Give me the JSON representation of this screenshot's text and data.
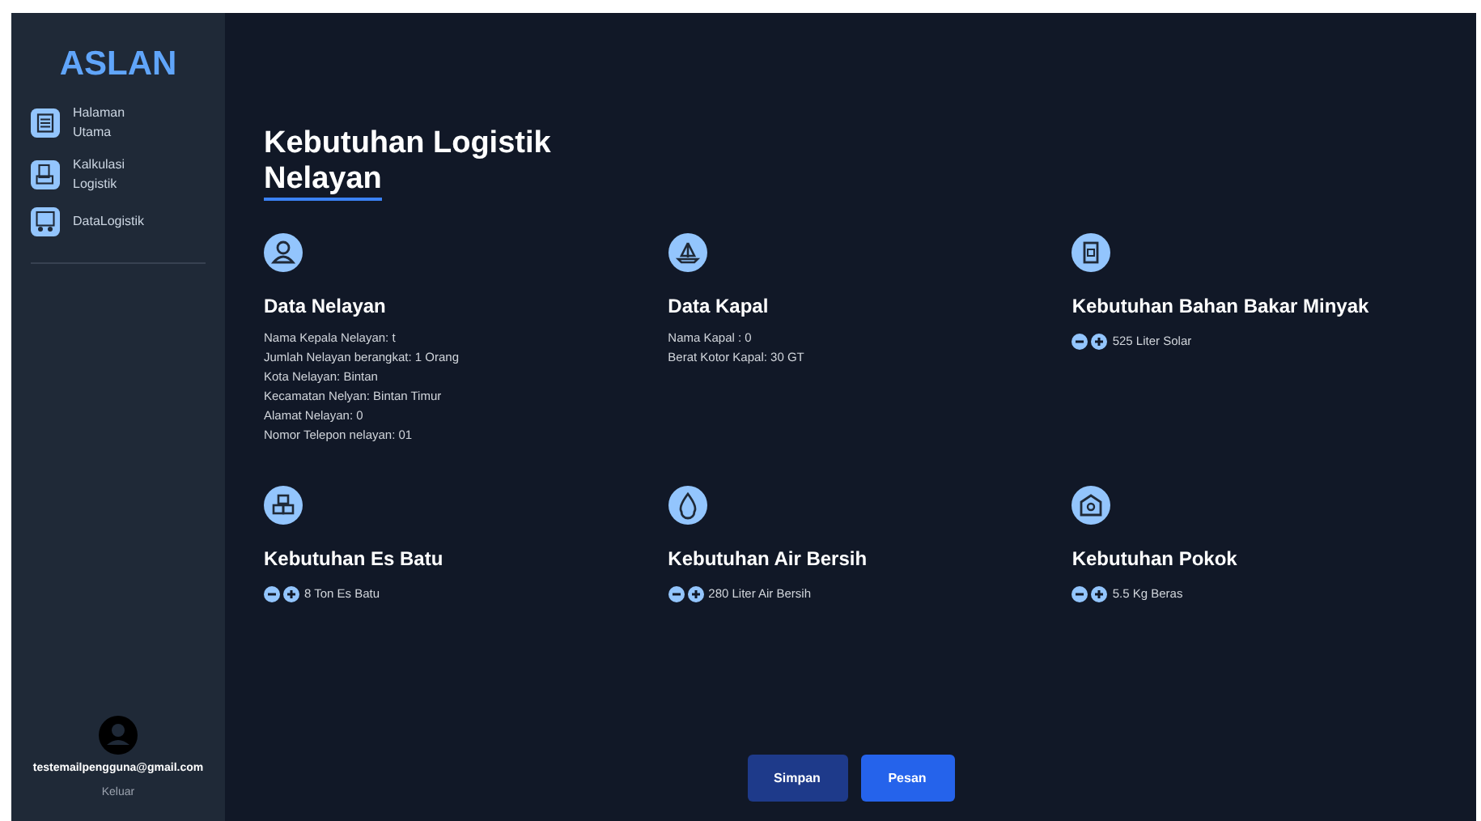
{
  "sidebar": {
    "brand": "ASLAN",
    "items": [
      {
        "label": "Halaman Utama"
      },
      {
        "label": "Kalkulasi Logistik"
      },
      {
        "label": "DataLogistik"
      }
    ],
    "user": {
      "email": "testemailpengguna@gmail.com",
      "logout": "Keluar"
    }
  },
  "title": "Kebutuhan Logistik",
  "title_underlined": "Nelayan",
  "cards": [
    {
      "kind": "info",
      "title": "Data Nelayan",
      "lines": [
        "Nama Kepala Nelayan: t",
        "Jumlah Nelayan berangkat: 1 Orang",
        "Kota Nelayan: Bintan",
        "Kecamatan Nelyan: Bintan Timur",
        "Alamat Nelayan: 0",
        "Nomor Telepon nelayan: 01"
      ]
    },
    {
      "kind": "info",
      "title": "Data Kapal",
      "lines": [
        "Nama Kapal : 0",
        "Berat Kotor Kapal: 30 GT"
      ]
    },
    {
      "kind": "counter",
      "title": "Kebutuhan Bahan Bakar Minyak",
      "value": "525 Liter Solar"
    },
    {
      "kind": "counter",
      "title": "Kebutuhan Es Batu",
      "value": "8 Ton Es Batu"
    },
    {
      "kind": "counter",
      "title": "Kebutuhan Air Bersih",
      "value": "280 Liter Air Bersih"
    },
    {
      "kind": "counter",
      "title": "Kebutuhan Pokok",
      "value": "5.5 Kg Beras"
    }
  ],
  "buttons": [
    {
      "label": "Simpan",
      "kind": "secondary"
    },
    {
      "label": "Pesan",
      "kind": "primary"
    }
  ]
}
